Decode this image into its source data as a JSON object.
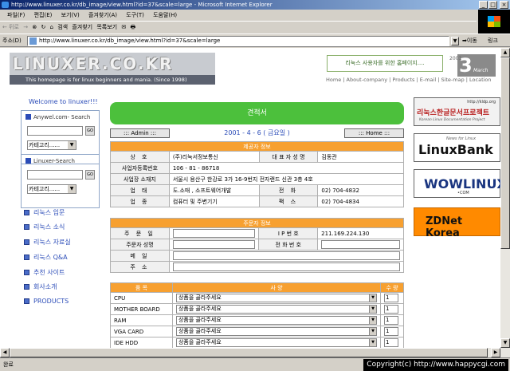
{
  "window": {
    "title": "http://www.linuxer.co.kr/db_image/view.html?id=37&scale=large - Microsoft Internet Explorer",
    "buttons": [
      "_",
      "□",
      "×"
    ]
  },
  "menu": [
    "파일(F)",
    "편집(E)",
    "보기(V)",
    "즐겨찾기(A)",
    "도구(T)",
    "도움말(H)"
  ],
  "toolbar": {
    "back": "← 뒤로",
    "forward": "→",
    "stop": "⊗",
    "refresh": "↻",
    "home": "⌂",
    "search": "검색",
    "favorites": "즐겨찾기",
    "history": "목록보기",
    "mail": "✉",
    "print": "🖶"
  },
  "address": {
    "label": "주소(D)",
    "url": "http://www.linuxer.co.kr/db_image/view.html?id=37&scale=large",
    "go": "이동",
    "links": "링크"
  },
  "status": {
    "text": "완료",
    "copyright": "Copyright(c) http://www.happycgi.com"
  },
  "site": {
    "logo": "LINUXER.CO.KR",
    "tagline": "This homepage is for linux beginners and mania. (Since 1998)",
    "slogan": "리눅스 사용자를 위한 홈페이지....",
    "date": {
      "year": "2001",
      "day": "3",
      "month": "March"
    },
    "topnav": "Home | About-company | Products | E-mail | Site-map | Location",
    "welcome": "Welcome to linuxer!!!",
    "search1": {
      "title": "Anywel.com- Search",
      "go": "GO",
      "category": "카테고리......"
    },
    "search2": {
      "title": "Linuxer-Search",
      "go": "GO",
      "category": "카테고리......"
    },
    "sidemenu": [
      "리눅스 입문",
      "리눅스 소식",
      "리눅스 자료실",
      "리눅스 Q&A",
      "추천 사이트",
      "회사소개",
      "PRODUCTS"
    ],
    "banners": {
      "b1": {
        "url": "http://kldp.org",
        "title": "리눅스한글문서프로젝트",
        "sub": "Korean Linux Documentation Project"
      },
      "b2": {
        "news": "News for Linux",
        "title": "LinuxBank"
      },
      "b3": {
        "title": "WOWLINUX",
        "com": "•COM"
      },
      "b4": {
        "title": "ZDNet Korea"
      }
    }
  },
  "doc": {
    "title": "견적서",
    "admin": "::: Admin :::",
    "home": "::: Home :::",
    "date": "2001 - 4 - 6 ( 금요일 )",
    "supplier": {
      "header": "제공자 정보",
      "rows": [
        {
          "l1": "상  호",
          "v1": "(주)리눅서정보통신",
          "l2": "대 표 자 성 명",
          "v2": "김동관"
        },
        {
          "l1": "사업자등록번호",
          "v1": "106 - 81 - 86718"
        },
        {
          "l1": "사업장 소재지",
          "v1": "서울시 용산구 한강로 3가 16-9번지 전자랜드 신관 3층 4호"
        },
        {
          "l1": "업  태",
          "v1": "도.소매 , 소프트웨어개발",
          "l2": "전  화",
          "v2": "02) 704-4832"
        },
        {
          "l1": "업  종",
          "v1": "컴퓨터 및 주변기기",
          "l2": "팩  스",
          "v2": "02) 704-4834"
        }
      ]
    },
    "orderer": {
      "header": "주문자 정보",
      "rows": [
        {
          "l1": "주 문 일",
          "l2": "I P 번 호",
          "v2": "211.169.224.130"
        },
        {
          "l1": "주문자 성명",
          "l2": "전 화 번 호"
        },
        {
          "l1": "메  일"
        },
        {
          "l1": "주  소"
        }
      ]
    },
    "items": {
      "h1": "품 목",
      "h2": "사 양",
      "h3": "수 량",
      "placeholder": "상품을 골라주세요",
      "qty": "1",
      "rows": [
        "CPU",
        "MOTHER BOARD",
        "RAM",
        "VGA CARD",
        "IDE HDD"
      ]
    }
  }
}
